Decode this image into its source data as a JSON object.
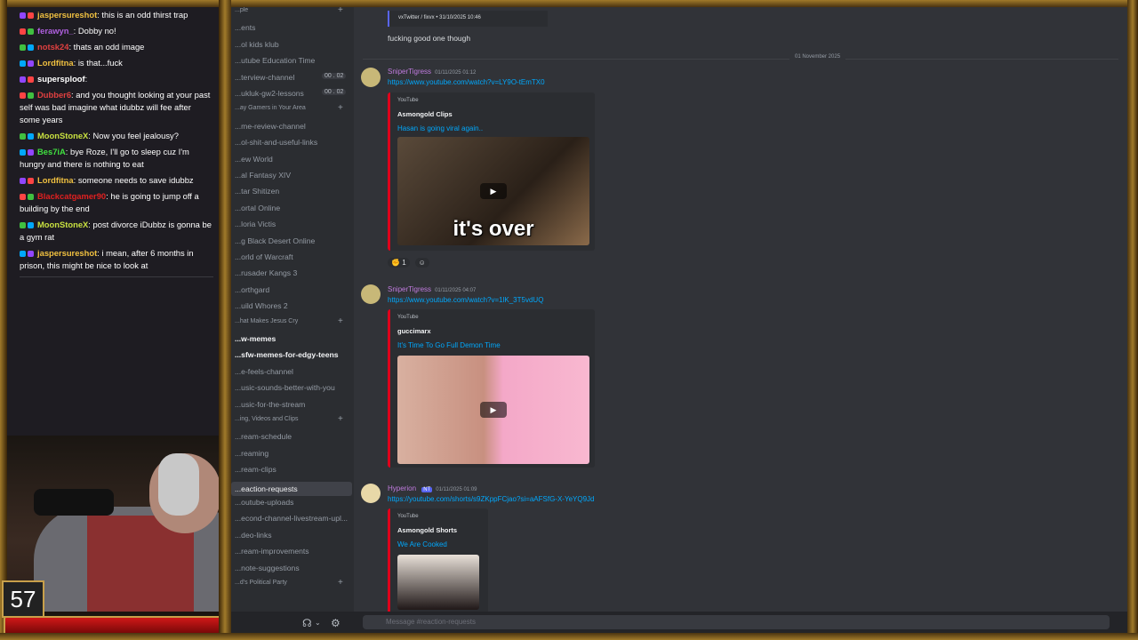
{
  "chat": {
    "messages": [
      {
        "user": "jaspersureshot",
        "user_color": "#f0c040",
        "text": ": this is an odd thirst trap"
      },
      {
        "user": "ferawyn_",
        "user_color": "#b060e0",
        "text": ": Dobby no!"
      },
      {
        "user": "notsk24",
        "user_color": "#e04040",
        "text": ": thats an odd image"
      },
      {
        "user": "Lordfitna",
        "user_color": "#f0c040",
        "text": ": is that...fuck"
      },
      {
        "user": "supersploof",
        "user_color": "#ffffff",
        "text": ":"
      },
      {
        "user": "Dubber6",
        "user_color": "#e04040",
        "text": ": and you thought looking at your past self was bad imagine what idubbz will fee after some years"
      },
      {
        "user": "MoonStoneX",
        "user_color": "#c8e040",
        "text": ": Now you feel jealousy?"
      },
      {
        "user": "Bes7iA",
        "user_color": "#40e040",
        "text": ": bye Roze, I'll go to sleep cuz I'm hungry and there is nothing to eat"
      },
      {
        "user": "Lordfitna",
        "user_color": "#f0c040",
        "text": ": someone needs to save idubbz"
      },
      {
        "user": "Blackcatgamer90",
        "user_color": "#e02020",
        "text": ": he is going to jump off a building by the end"
      },
      {
        "user": "MoonStoneX",
        "user_color": "#c8e040",
        "text": ": post divorce iDubbz is gonna be a gym rat"
      },
      {
        "user": "jaspersureshot",
        "user_color": "#f0c040",
        "text": ": i mean, after 6 months in prison, this might be nice to look at"
      }
    ]
  },
  "overlay": {
    "counter": "57"
  },
  "sidebar": {
    "channels": [
      {
        "label": "...ple",
        "kind": "cat"
      },
      {
        "label": "...ents",
        "kind": "normal"
      },
      {
        "label": "...ol kids klub",
        "kind": "normal"
      },
      {
        "label": "...utube Education Time",
        "kind": "normal"
      },
      {
        "label": "...terview-channel",
        "kind": "normal",
        "badge": "00 . 02"
      },
      {
        "label": "...ukluk-gw2-lessons",
        "kind": "normal",
        "badge": "00 . 02"
      },
      {
        "label": "...ay Gamers in Your Area",
        "kind": "cat"
      },
      {
        "label": "...me-review-channel",
        "kind": "normal"
      },
      {
        "label": "...ol-shit-and-useful-links",
        "kind": "normal"
      },
      {
        "label": "...ew World",
        "kind": "normal"
      },
      {
        "label": "...al Fantasy XIV",
        "kind": "normal"
      },
      {
        "label": "...tar Shitizen",
        "kind": "normal"
      },
      {
        "label": "...ortal Online",
        "kind": "normal"
      },
      {
        "label": "...loria Victis",
        "kind": "normal"
      },
      {
        "label": "...g Black Desert Online",
        "kind": "normal"
      },
      {
        "label": "...orld of Warcraft",
        "kind": "normal"
      },
      {
        "label": "...rusader Kangs 3",
        "kind": "normal"
      },
      {
        "label": "...orthgard",
        "kind": "normal"
      },
      {
        "label": "...uild Whores 2",
        "kind": "normal"
      },
      {
        "label": "...hat Makes Jesus Cry",
        "kind": "cat"
      },
      {
        "label": "...w-memes",
        "kind": "bold"
      },
      {
        "label": "...sfw-memes-for-edgy-teens",
        "kind": "bold"
      },
      {
        "label": "...e-feels-channel",
        "kind": "normal"
      },
      {
        "label": "...usic-sounds-better-with-you",
        "kind": "normal"
      },
      {
        "label": "...usic-for-the-stream",
        "kind": "normal"
      },
      {
        "label": "...ing, Videos and Clips",
        "kind": "cat"
      },
      {
        "label": "...ream-schedule",
        "kind": "normal"
      },
      {
        "label": "...reaming",
        "kind": "normal"
      },
      {
        "label": "...ream-clips",
        "kind": "normal"
      },
      {
        "label": "...eaction-requests",
        "kind": "sel"
      },
      {
        "label": "...outube-uploads",
        "kind": "normal"
      },
      {
        "label": "...econd-channel-livestream-upl...",
        "kind": "normal"
      },
      {
        "label": "...deo-links",
        "kind": "normal"
      },
      {
        "label": "...ream-improvements",
        "kind": "normal"
      },
      {
        "label": "...note-suggestions",
        "kind": "normal"
      },
      {
        "label": "...d's Political Party",
        "kind": "cat"
      }
    ]
  },
  "messages": {
    "reply_preview": "vxTwitter / fixvx • 31/10/2025 10:46",
    "first_text": "fucking good one though",
    "date_divider": "01 November 2025",
    "posts": [
      {
        "author": "SniperTigress",
        "author_color": "#c07bde",
        "time": "01/11/2025 01:12",
        "link": "https://www.youtube.com/watch?v=LY9O-tEmTX0",
        "provider": "YouTube",
        "channel": "Asmongold Clips",
        "title": "Hasan is going viral again..",
        "thumb_text": "it's over"
      },
      {
        "author": "SniperTigress",
        "author_color": "#c07bde",
        "time": "01/11/2025 04:07",
        "link": "https://www.youtube.com/watch?v=1lK_3T5vdUQ",
        "provider": "YouTube",
        "channel": "guccimarx",
        "title": "It's Time To Go Full Demon Time",
        "thumb_text": ""
      },
      {
        "author": "Hyperion",
        "author_color": "#c07bde",
        "time": "01/11/2025 01:09",
        "tag": "NT",
        "link": "https://youtube.com/shorts/s9ZKppFCjao?si=aAFSfG-X-YeYQ9Jd",
        "provider": "YouTube",
        "channel": "Asmongold Shorts",
        "title": "We Are Cooked",
        "thumb_text": ""
      }
    ],
    "reaction_count": "1"
  },
  "composer": {
    "placeholder": "Message #reaction-requests"
  },
  "colors": {
    "accent": "#5865f2",
    "link": "#00a8fc",
    "youtube_red": "#e0001b",
    "frame_gold": "#a07a2a"
  }
}
